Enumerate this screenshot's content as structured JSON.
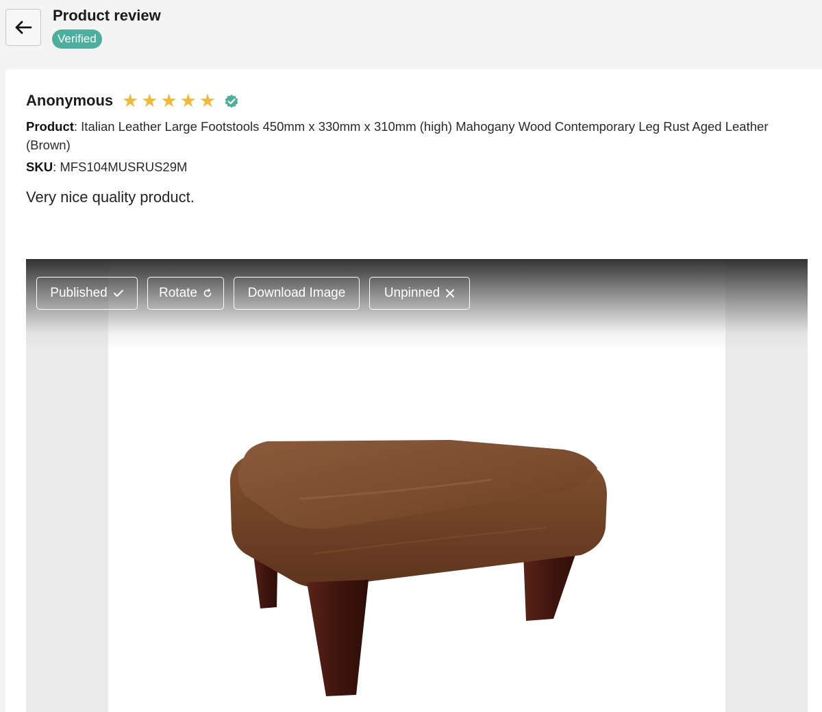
{
  "header": {
    "back_icon": "arrow-left-icon",
    "title": "Product review",
    "badge": "Verified"
  },
  "review": {
    "reviewer": "Anonymous",
    "rating": 5,
    "max_rating": 5,
    "star_char": "★",
    "verified_icon": "verified-check-icon",
    "product_label": "Product",
    "product_value": ": Italian Leather Large Footstools 450mm x 330mm x 310mm (high) Mahogany Wood Contemporary Leg Rust Aged Leather (Brown)",
    "sku_label": "SKU",
    "sku_value": ": MFS104MUSRUS29M",
    "text": "Very nice quality product."
  },
  "image_toolbar": {
    "published_label": "Published",
    "rotate_label": "Rotate",
    "download_label": "Download Image",
    "unpinned_label": "Unpinned"
  },
  "colors": {
    "accent": "#4cae9c",
    "star": "#f1b93a",
    "leather": "#7a4a2c",
    "wood": "#4a1c12"
  }
}
